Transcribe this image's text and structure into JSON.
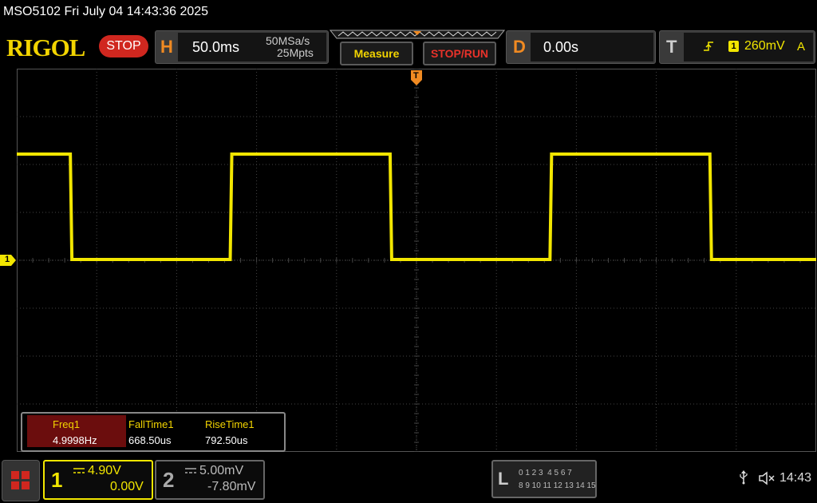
{
  "title_bar": "MSO5102  Fri July 04 14:43:36 2025",
  "brand": "RIGOL",
  "run_state": "STOP",
  "horizontal": {
    "key": "H",
    "timebase": "50.0ms",
    "sample_rate": "50MSa/s",
    "memory_depth": "25Mpts"
  },
  "buttons": {
    "measure": "Measure",
    "stop_run": "STOP/RUN"
  },
  "delay": {
    "key": "D",
    "value": "0.00s"
  },
  "trigger": {
    "key": "T",
    "source": "1",
    "level": "260mV",
    "mode": "A"
  },
  "channel_marker": "1",
  "trigger_marker": "T",
  "measurements": {
    "headers": [
      "Freq1",
      "FallTime1",
      "RiseTime1"
    ],
    "values": [
      "4.9998Hz",
      "668.50us",
      "792.50us"
    ]
  },
  "channels": [
    {
      "id": "1",
      "scale": "4.90V",
      "offset": "0.00V",
      "active": true
    },
    {
      "id": "2",
      "scale": "5.00mV",
      "offset": "-7.80mV",
      "active": false
    }
  ],
  "logic": {
    "key": "L",
    "row1": "0 1 2 3  4 5 6 7",
    "row2": "8 9 10 11 12 13 14 15"
  },
  "status": {
    "time": "14:43",
    "usb_icon": "usb-icon",
    "sound_icon": "mute-icon"
  },
  "colors": {
    "ch1": "#f2e600",
    "accent": "#f08a22",
    "stop": "#d0271f",
    "grid": "#444"
  },
  "waveform": {
    "period_divs": 4.0,
    "first_fall_div": 0.67,
    "high_level_div": -2.2,
    "low_level_div": 0.0
  }
}
